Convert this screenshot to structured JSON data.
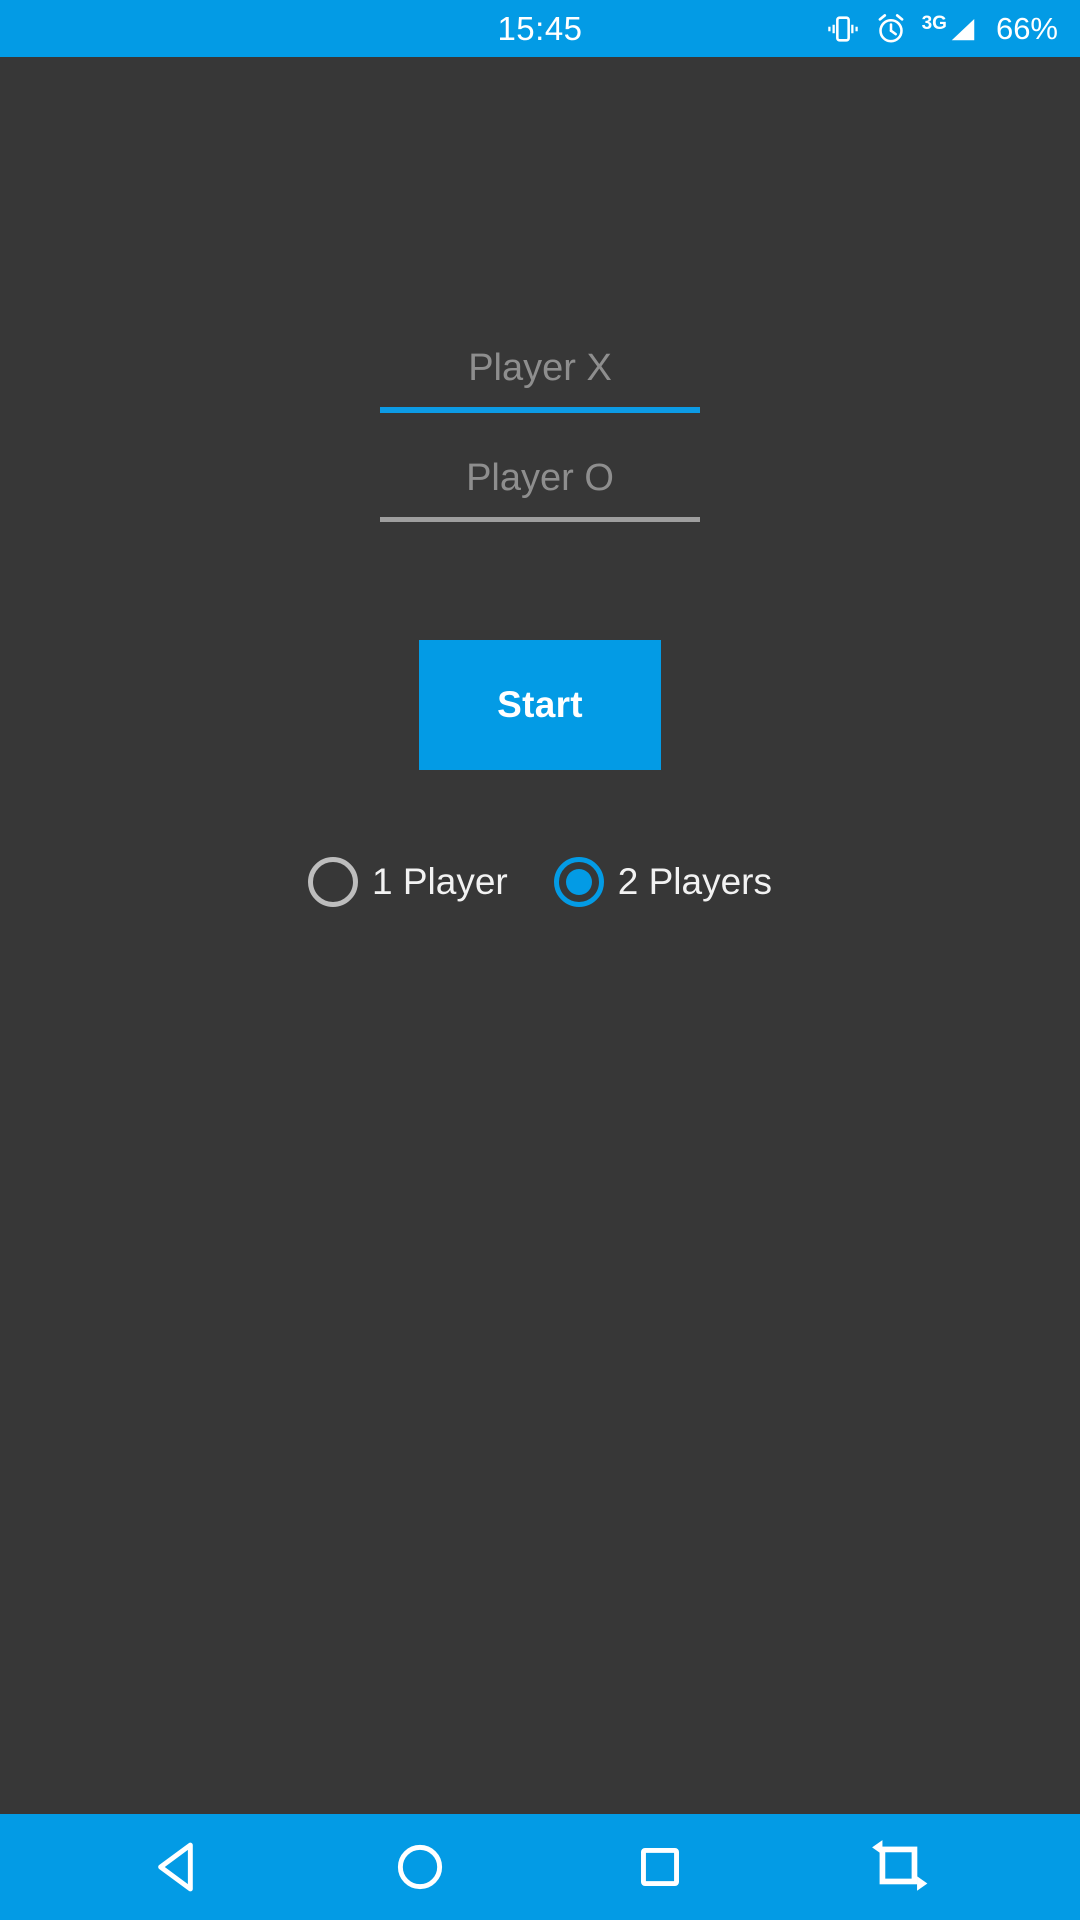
{
  "status_bar": {
    "clock": "15:45",
    "battery": "66%",
    "network_type": "3G",
    "icons": [
      "vibrate-icon",
      "alarm-clock-icon",
      "signal-3g-icon",
      "battery-percent"
    ],
    "background_color": "#039BE5",
    "text_color": "#FFFFFF"
  },
  "app": {
    "background_color": "#373737",
    "accent_color": "#039BE5",
    "fields": [
      {
        "name": "player-x",
        "placeholder": "Player X",
        "value": "",
        "focused": true,
        "underline_color": "#0C9BE5"
      },
      {
        "name": "player-o",
        "placeholder": "Player O",
        "value": "",
        "focused": false,
        "underline_color": "#9E9E9E"
      }
    ],
    "start_button": {
      "label": "Start",
      "background_color": "#039BE5",
      "text_color": "#FFFFFF"
    },
    "mode_options": [
      {
        "label": "1 Player",
        "selected": false
      },
      {
        "label": "2 Players",
        "selected": true
      }
    ]
  },
  "nav_bar": {
    "background_color": "#039BE5",
    "buttons": [
      {
        "name": "back-icon",
        "label": "Back"
      },
      {
        "name": "home-icon",
        "label": "Home"
      },
      {
        "name": "recents-icon",
        "label": "Recent apps"
      },
      {
        "name": "rotate-screen-icon",
        "label": "Rotate screen"
      }
    ]
  }
}
